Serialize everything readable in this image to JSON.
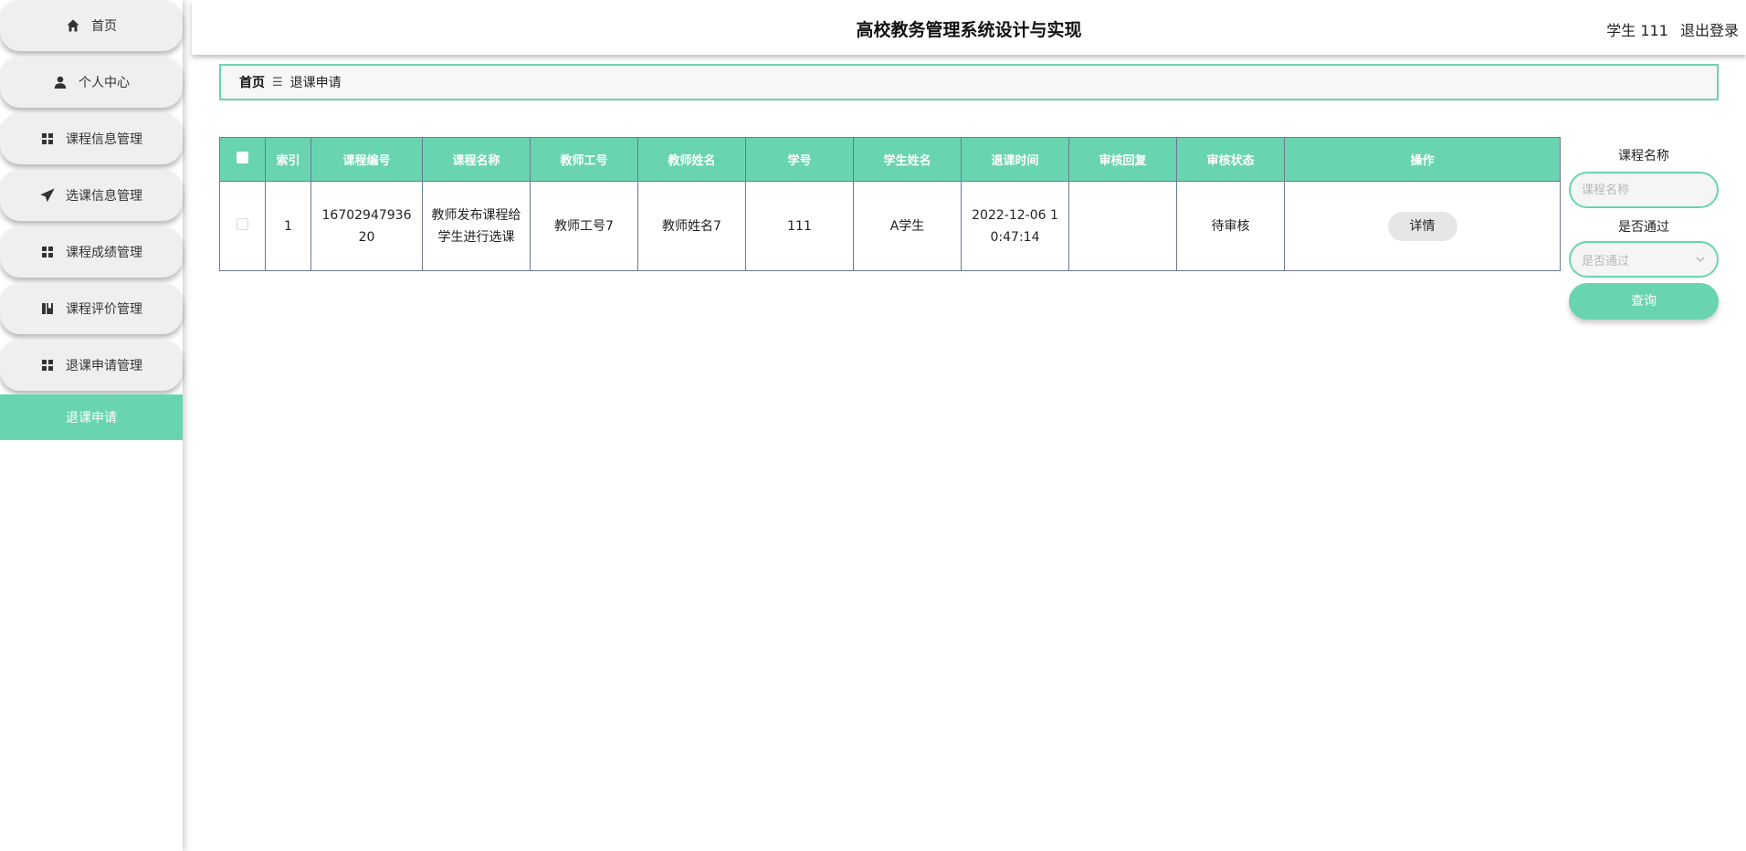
{
  "app": {
    "title": "高校教务管理系统设计与实现",
    "user_label": "学生 111",
    "logout_label": "退出登录"
  },
  "sidebar": {
    "items": [
      {
        "label": "首页",
        "icon": "home-icon"
      },
      {
        "label": "个人中心",
        "icon": "user-icon"
      },
      {
        "label": "课程信息管理",
        "icon": "grid-icon"
      },
      {
        "label": "选课信息管理",
        "icon": "send-icon"
      },
      {
        "label": "课程成绩管理",
        "icon": "grid-icon"
      },
      {
        "label": "课程评价管理",
        "icon": "book-icon"
      },
      {
        "label": "退课申请管理",
        "icon": "grid-icon"
      }
    ],
    "active_item": {
      "label": "退课申请"
    }
  },
  "breadcrumb": {
    "home": "首页",
    "separator": "☰",
    "current": "退课申请"
  },
  "table": {
    "headers": [
      "索引",
      "课程编号",
      "课程名称",
      "教师工号",
      "教师姓名",
      "学号",
      "学生姓名",
      "退课时间",
      "审核回复",
      "审核状态",
      "操作"
    ],
    "rows": [
      {
        "index": "1",
        "course_no": "1670294793620",
        "course_name": "教师发布课程给学生进行选课",
        "teacher_no": "教师工号7",
        "teacher_name": "教师姓名7",
        "student_no": "111",
        "student_name": "A学生",
        "drop_time": "2022-12-06 10:47:14",
        "review_reply": "",
        "review_status": "待审核",
        "action_label": "详情"
      }
    ]
  },
  "search": {
    "course_name_label": "课程名称",
    "course_name_placeholder": "课程名称",
    "passed_label": "是否通过",
    "passed_placeholder": "是否通过",
    "query_label": "查询"
  },
  "colors": {
    "accent": "#69d4b0",
    "table_border": "#6b7a8f",
    "menu_bg": "#efefef"
  }
}
